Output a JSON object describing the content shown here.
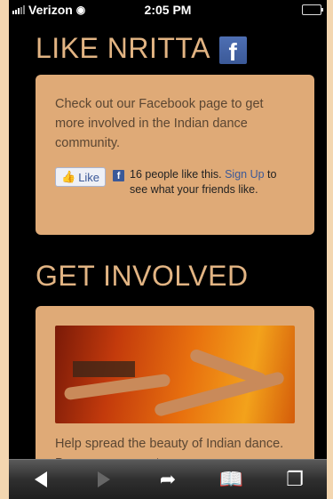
{
  "status_bar": {
    "carrier": "Verizon",
    "time": "2:05 PM"
  },
  "sections": {
    "like": {
      "heading": "LIKE NRITTA",
      "fb_logo": "f",
      "description": "Check out our Facebook page to get more involved in the Indian dance community.",
      "like_button_label": "Like",
      "like_count_text": "16 people like this.",
      "signup_link": "Sign Up",
      "signup_suffix": "to see what your friends like."
    },
    "involved": {
      "heading": "GET INVOLVED",
      "photo_alt": "dancers",
      "description": "Help spread the beauty of Indian dance. Become a supporter..."
    }
  },
  "toolbar": {
    "icons": [
      "back-icon",
      "forward-icon",
      "share-icon",
      "bookmarks-icon",
      "tabs-icon"
    ]
  },
  "colors": {
    "accent": "#e2b483",
    "card": "#dfaa77",
    "facebook": "#3b5998"
  }
}
